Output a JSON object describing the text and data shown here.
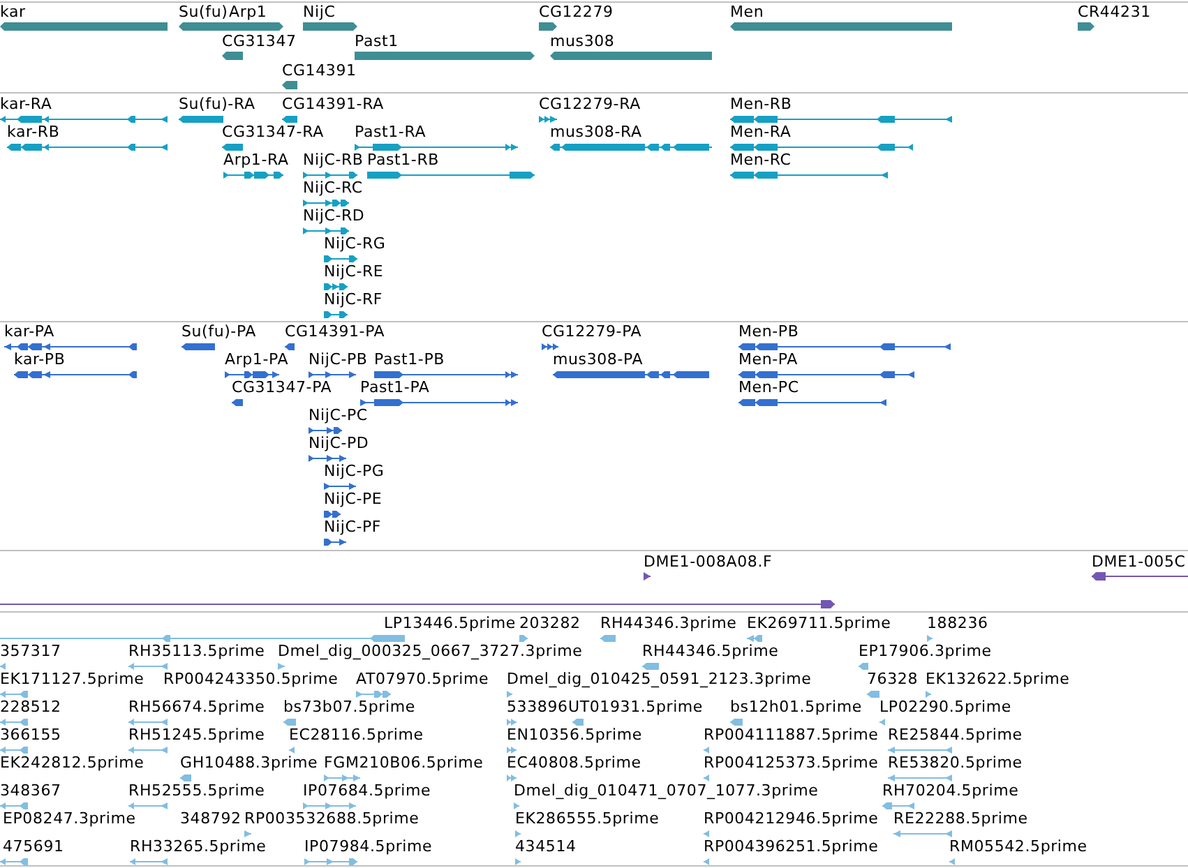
{
  "tracks": [
    {
      "kind": "gene",
      "color": "#3f8e94",
      "features": [
        {
          "label": "kar",
          "reverse": true
        },
        {
          "label": "Su(fu)",
          "reverse": true
        },
        {
          "label": "Arp1",
          "reverse": false
        },
        {
          "label": "NijC",
          "reverse": false
        },
        {
          "label": "CG12279",
          "reverse": false
        },
        {
          "label": "Men",
          "reverse": true
        },
        {
          "label": "CR44231",
          "reverse": false
        },
        {
          "label": "CG31347",
          "reverse": true
        },
        {
          "label": "Past1",
          "reverse": false
        },
        {
          "label": "mus308",
          "reverse": true
        },
        {
          "label": "CG14391",
          "reverse": true
        }
      ]
    },
    {
      "kind": "transcript",
      "color": "#16a0c4",
      "features": [
        {
          "label": "kar-RA",
          "reverse": true
        },
        {
          "label": "Su(fu)-RA",
          "reverse": true
        },
        {
          "label": "CG14391-RA",
          "reverse": true
        },
        {
          "label": "CG12279-RA",
          "reverse": false
        },
        {
          "label": "Men-RB",
          "reverse": true
        },
        {
          "label": "kar-RB",
          "reverse": true
        },
        {
          "label": "CG31347-RA",
          "reverse": true
        },
        {
          "label": "Past1-RA",
          "reverse": false
        },
        {
          "label": "mus308-RA",
          "reverse": true
        },
        {
          "label": "Men-RA",
          "reverse": true
        },
        {
          "label": "Arp1-RA",
          "reverse": false
        },
        {
          "label": "NijC-RB",
          "reverse": false
        },
        {
          "label": "Past1-RB",
          "reverse": false
        },
        {
          "label": "Men-RC",
          "reverse": true
        },
        {
          "label": "NijC-RC",
          "reverse": false
        },
        {
          "label": "NijC-RD",
          "reverse": false
        },
        {
          "label": "NijC-RG",
          "reverse": false
        },
        {
          "label": "NijC-RE",
          "reverse": false
        },
        {
          "label": "NijC-RF",
          "reverse": false
        }
      ]
    },
    {
      "kind": "protein",
      "color": "#3370d0",
      "features": [
        {
          "label": "kar-PA",
          "reverse": true
        },
        {
          "label": "Su(fu)-PA",
          "reverse": true
        },
        {
          "label": "CG14391-PA",
          "reverse": true
        },
        {
          "label": "CG12279-PA",
          "reverse": false
        },
        {
          "label": "Men-PB",
          "reverse": true
        },
        {
          "label": "kar-PB",
          "reverse": true
        },
        {
          "label": "Arp1-PA",
          "reverse": false
        },
        {
          "label": "NijC-PB",
          "reverse": false
        },
        {
          "label": "Past1-PB",
          "reverse": false
        },
        {
          "label": "mus308-PA",
          "reverse": true
        },
        {
          "label": "Men-PA",
          "reverse": true
        },
        {
          "label": "CG31347-PA",
          "reverse": true
        },
        {
          "label": "Past1-PA",
          "reverse": false
        },
        {
          "label": "Men-PC",
          "reverse": true
        },
        {
          "label": "NijC-PC",
          "reverse": false
        },
        {
          "label": "NijC-PD",
          "reverse": false
        },
        {
          "label": "NijC-PG",
          "reverse": false
        },
        {
          "label": "NijC-PE",
          "reverse": false
        },
        {
          "label": "NijC-PF",
          "reverse": false
        }
      ]
    },
    {
      "kind": "clone",
      "color": "#7356b4",
      "features": [
        {
          "label": "DME1-008A08.F",
          "reverse": false
        },
        {
          "label": "DME1-005C",
          "reverse": true
        },
        {
          "reverse": false
        }
      ]
    },
    {
      "kind": "est",
      "color": "#82bde2",
      "features": [
        {
          "reverse": true
        },
        {
          "label": "LP13446.5prime",
          "reverse": true
        },
        {
          "label": "203282",
          "reverse": false
        },
        {
          "label": "RH44346.3prime",
          "reverse": true
        },
        {
          "label": "EK269711.5prime",
          "reverse": true
        },
        {
          "label": "188236",
          "reverse": false
        },
        {
          "label": "357317",
          "reverse": true
        },
        {
          "label": "RH35113.5prime",
          "reverse": true
        },
        {
          "label": "Dmel_dig_000325_0667_3727.3prime",
          "reverse": false
        },
        {
          "label": "RH44346.5prime",
          "reverse": true
        },
        {
          "label": "EP17906.3prime",
          "reverse": true
        },
        {
          "label": "EK171127.5prime",
          "reverse": true
        },
        {
          "label": "RP004243350.5prime"
        },
        {
          "label": "AT07970.5prime",
          "reverse": false
        },
        {
          "label": "Dmel_dig_010425_0591_2123.3prime",
          "reverse": false
        },
        {
          "label": "76328",
          "reverse": true
        },
        {
          "label": "EK132622.5prime",
          "reverse": false
        },
        {
          "label": "228512",
          "reverse": true
        },
        {
          "label": "RH56674.5prime",
          "reverse": true
        },
        {
          "label": "bs73b07.5prime",
          "reverse": true
        },
        {
          "label": "533896",
          "reverse": false
        },
        {
          "label": "UT01931.5prime",
          "reverse": true
        },
        {
          "label": "bs12h01.5prime",
          "reverse": true
        },
        {
          "label": "LP02290.5prime",
          "reverse": true
        },
        {
          "label": "366155",
          "reverse": true
        },
        {
          "label": "RH51245.5prime",
          "reverse": true
        },
        {
          "label": "EC28116.5prime",
          "reverse": true
        },
        {
          "label": "EN10356.5prime",
          "reverse": false
        },
        {
          "label": "RP004111887.5prime",
          "reverse": true
        },
        {
          "label": "RE25844.5prime",
          "reverse": true
        },
        {
          "label": "EK242812.5prime"
        },
        {
          "label": "GH10488.3prime",
          "reverse": true
        },
        {
          "label": "FGM210B06.5prime",
          "reverse": false
        },
        {
          "label": "EC40808.5prime",
          "reverse": false
        },
        {
          "label": "RP004125373.5prime",
          "reverse": true
        },
        {
          "label": "RE53820.5prime",
          "reverse": true
        },
        {
          "label": "348367",
          "reverse": true
        },
        {
          "label": "RH52555.5prime",
          "reverse": true
        },
        {
          "label": "IP07684.5prime",
          "reverse": false
        },
        {
          "label": "Dmel_dig_010471_0707_1077.3prime",
          "reverse": false
        },
        {
          "label": "RH70204.5prime",
          "reverse": true
        },
        {
          "label": "EP08247.3prime"
        },
        {
          "label": "348792"
        },
        {
          "label": "RP003532688.5prime",
          "reverse": false
        },
        {
          "label": "EK286555.5prime",
          "reverse": false
        },
        {
          "label": "RP004212946.5prime",
          "reverse": true
        },
        {
          "label": "RE22288.5prime",
          "reverse": true
        },
        {
          "label": "475691",
          "reverse": true
        },
        {
          "label": "RH33265.5prime",
          "reverse": true
        },
        {
          "label": "IP07984.5prime",
          "reverse": false
        },
        {
          "label": "434514",
          "reverse": false
        },
        {
          "label": "RP004396251.5prime",
          "reverse": true
        },
        {
          "label": "RM05542.5prime",
          "reverse": true
        }
      ]
    }
  ]
}
